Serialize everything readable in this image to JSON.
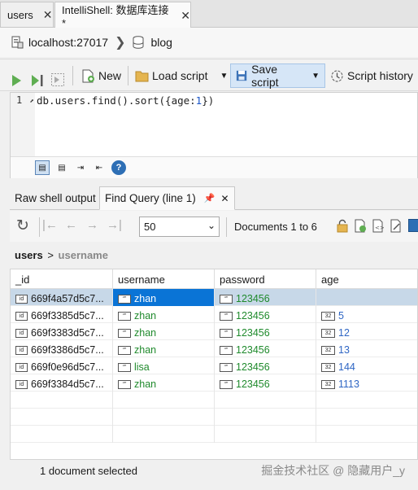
{
  "tabs": [
    {
      "label": "users"
    },
    {
      "label": "IntelliShell: 数据库连接*"
    }
  ],
  "connection": {
    "host": "localhost:27017",
    "database": "blog"
  },
  "toolbar": {
    "new_label": "New",
    "load_label": "Load script",
    "save_label": "Save script",
    "history_label": "Script history"
  },
  "editor": {
    "line_number": "1",
    "code_prefix": "db.users.find().sort({age:",
    "code_num": "1",
    "code_suffix": "})"
  },
  "result_tabs": [
    {
      "label": "Raw shell output"
    },
    {
      "label": "Find Query (line 1)"
    }
  ],
  "result_toolbar": {
    "page_size": "50",
    "documents_label": "Documents 1 to 6"
  },
  "breadcrumb": {
    "collection": "users",
    "field": "username"
  },
  "table": {
    "columns": [
      "_id",
      "username",
      "password",
      "age"
    ],
    "rows": [
      {
        "id": "669f4a57d5c7...",
        "username": "zhan",
        "password": "123456",
        "age": ""
      },
      {
        "id": "669f3385d5c7...",
        "username": "zhan",
        "password": "123456",
        "age": "5"
      },
      {
        "id": "669f3383d5c7...",
        "username": "zhan",
        "password": "123456",
        "age": "12"
      },
      {
        "id": "669f3386d5c7...",
        "username": "zhan",
        "password": "123456",
        "age": "13"
      },
      {
        "id": "669f0e96d5c7...",
        "username": "lisa",
        "password": "123456",
        "age": "144"
      },
      {
        "id": "669f3384d5c7...",
        "username": "zhan",
        "password": "123456",
        "age": "1113"
      }
    ]
  },
  "status": {
    "text": "1 document selected"
  },
  "watermark": "掘金技术社区 @ 隐藏用户_y",
  "colors": {
    "selection": "#0a74d6",
    "string_value": "#1f8a2c",
    "number_value": "#2f66c4",
    "row_selected": "#c7d8e8"
  },
  "icons": [
    "server-icon",
    "database-icon",
    "run-icon",
    "run-step-icon",
    "stop-icon",
    "new-script-icon",
    "folder-icon",
    "save-icon",
    "history-icon",
    "refresh-icon",
    "pin-icon",
    "lock-icon",
    "add-document-icon",
    "export-icon",
    "edit-icon"
  ]
}
